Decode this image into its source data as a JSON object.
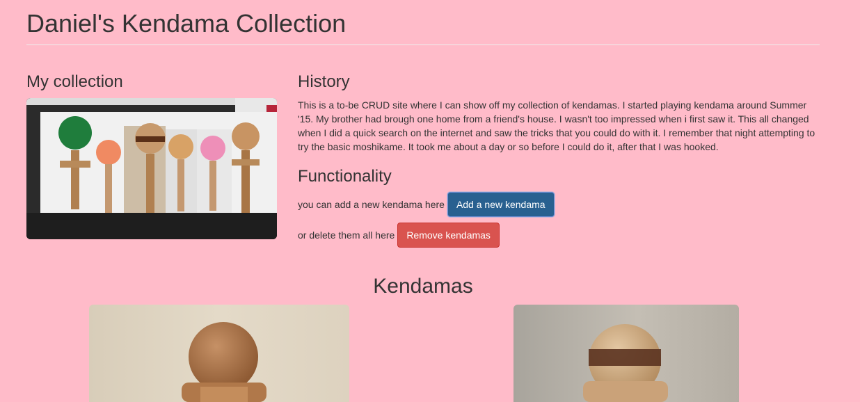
{
  "header": {
    "title": "Daniel's Kendama Collection"
  },
  "collection": {
    "heading": "My collection",
    "photo_alt": "Kendama collection on a shelf"
  },
  "history": {
    "heading": "History",
    "text": "This is a to-be CRUD site where I can show off my collection of kendamas. I started playing kendama around Summer '15. My brother had brough one home from a friend's house. I wasn't too impressed when i first saw it. This all changed when I did a quick search on the internet and saw the tricks that you could do with it. I remember that night attempting to try the basic moshikame. It took me about a day or so before I could do it, after that I was hooked."
  },
  "functionality": {
    "heading": "Functionality",
    "add_text": "you can add a new kendama here",
    "add_button": "Add a new kendama",
    "remove_text": "or delete them all here",
    "remove_button": "Remove kendamas"
  },
  "kendamas": {
    "heading": "Kendamas",
    "cards": [
      {
        "name": "kendama-card-1"
      },
      {
        "name": "kendama-card-2"
      }
    ]
  },
  "colors": {
    "background": "#ffbbc9",
    "primary": "#286090",
    "danger": "#d9534f",
    "text": "#333333"
  }
}
